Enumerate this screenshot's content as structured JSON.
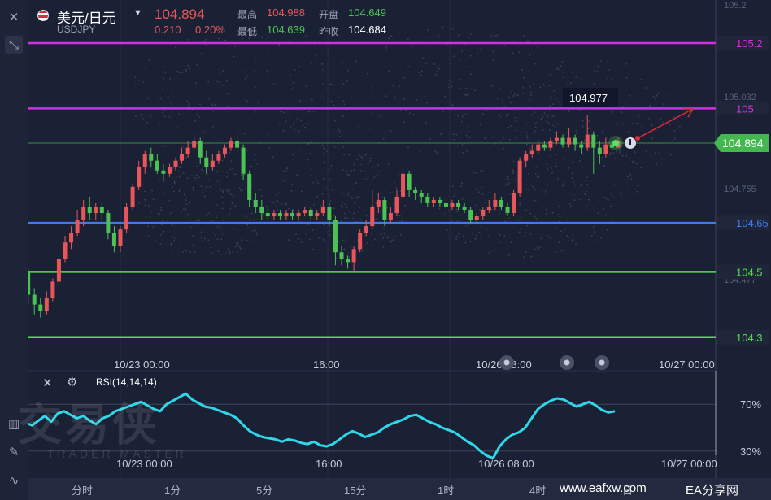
{
  "header": {
    "pair": "美元/日元",
    "symbol": "USDJPY",
    "price": "104.894",
    "change": "0.210",
    "change_pct": "0.20%",
    "high_label": "最高",
    "high": "104.988",
    "low_label": "最低",
    "low": "104.639",
    "open_label": "开盘",
    "open": "104.649",
    "prev_label": "昨收",
    "prev": "104.684"
  },
  "price_axis": {
    "ticks": [
      "105.2",
      "105.032",
      "104.755",
      "104.477"
    ],
    "current": "104.894"
  },
  "levels": [
    {
      "label": "105.2",
      "value": 105.2,
      "color": "#d62ee0"
    },
    {
      "label": "105",
      "value": 105.0,
      "color": "#d62ee0"
    },
    {
      "label": "104.65",
      "value": 104.65,
      "color": "#3d7bf0"
    },
    {
      "label": "104.5",
      "value": 104.5,
      "color": "#52e04a"
    },
    {
      "label": "104.3",
      "value": 104.3,
      "color": "#52e04a"
    }
  ],
  "peak_tooltip": "104.977",
  "time_axis": [
    "10/23 00:00",
    "16:00",
    "10/26 08:00",
    "10/27 00:00"
  ],
  "rsi": {
    "label": "RSI(14,14,14)",
    "levels": [
      "70%",
      "30%"
    ]
  },
  "periods": [
    "分时",
    "1分",
    "5分",
    "15分",
    "1时",
    "4时",
    "日"
  ],
  "watermark": {
    "brand": "交易侠",
    "brand_sub": "TRADER MASTER",
    "site": "www.eafxw.com",
    "name": "EA分享网"
  },
  "colors": {
    "up": "#e8565c",
    "down": "#4cc254",
    "rsi": "#2fd7e8",
    "bg": "#1b2134"
  },
  "chart_data": {
    "type": "candlestick",
    "symbol": "USDJPY",
    "ylim": [
      104.3,
      105.2
    ],
    "candles": [
      [
        104.57,
        104.56,
        104.6,
        104.53
      ],
      [
        104.56,
        104.55,
        104.58,
        104.52
      ],
      [
        104.55,
        104.5,
        104.56,
        104.48
      ],
      [
        104.5,
        104.43,
        104.51,
        104.4
      ],
      [
        104.43,
        104.4,
        104.45,
        104.37
      ],
      [
        104.4,
        104.38,
        104.42,
        104.36
      ],
      [
        104.38,
        104.42,
        104.44,
        104.37
      ],
      [
        104.42,
        104.47,
        104.48,
        104.41
      ],
      [
        104.47,
        104.54,
        104.55,
        104.46
      ],
      [
        104.54,
        104.59,
        104.61,
        104.53
      ],
      [
        104.59,
        104.62,
        104.64,
        104.57
      ],
      [
        104.62,
        104.66,
        104.69,
        104.61
      ],
      [
        104.66,
        104.7,
        104.72,
        104.64
      ],
      [
        104.7,
        104.68,
        104.73,
        104.66
      ],
      [
        104.68,
        104.7,
        104.71,
        104.66
      ],
      [
        104.7,
        104.68,
        104.71,
        104.66
      ],
      [
        104.68,
        104.62,
        104.69,
        104.6
      ],
      [
        104.62,
        104.58,
        104.64,
        104.56
      ],
      [
        104.58,
        104.63,
        104.64,
        104.56
      ],
      [
        104.63,
        104.7,
        104.71,
        104.62
      ],
      [
        104.7,
        104.76,
        104.77,
        104.69
      ],
      [
        104.76,
        104.82,
        104.84,
        104.75
      ],
      [
        104.82,
        104.86,
        104.87,
        104.8
      ],
      [
        104.86,
        104.84,
        104.88,
        104.82
      ],
      [
        104.84,
        104.81,
        104.86,
        104.8
      ],
      [
        104.81,
        104.8,
        104.83,
        104.78
      ],
      [
        104.8,
        104.82,
        104.83,
        104.79
      ],
      [
        104.82,
        104.84,
        104.85,
        104.81
      ],
      [
        104.84,
        104.86,
        104.88,
        104.83
      ],
      [
        104.86,
        104.88,
        104.9,
        104.85
      ],
      [
        104.88,
        104.9,
        104.92,
        104.87
      ],
      [
        104.9,
        104.85,
        104.91,
        104.83
      ],
      [
        104.85,
        104.82,
        104.87,
        104.8
      ],
      [
        104.82,
        104.84,
        104.86,
        104.81
      ],
      [
        104.84,
        104.86,
        104.87,
        104.83
      ],
      [
        104.86,
        104.88,
        104.89,
        104.85
      ],
      [
        104.88,
        104.9,
        104.91,
        104.87
      ],
      [
        104.9,
        104.88,
        104.92,
        104.86
      ],
      [
        104.88,
        104.8,
        104.89,
        104.78
      ],
      [
        104.8,
        104.72,
        104.81,
        104.7
      ],
      [
        104.72,
        104.7,
        104.74,
        104.68
      ],
      [
        104.7,
        104.68,
        104.72,
        104.66
      ],
      [
        104.68,
        104.67,
        104.7,
        104.66
      ],
      [
        104.67,
        104.68,
        104.69,
        104.66
      ],
      [
        104.68,
        104.67,
        104.69,
        104.66
      ],
      [
        104.67,
        104.68,
        104.69,
        104.66
      ],
      [
        104.68,
        104.67,
        104.69,
        104.66
      ],
      [
        104.67,
        104.68,
        104.69,
        104.66
      ],
      [
        104.68,
        104.69,
        104.7,
        104.67
      ],
      [
        104.69,
        104.67,
        104.7,
        104.66
      ],
      [
        104.67,
        104.68,
        104.69,
        104.66
      ],
      [
        104.68,
        104.7,
        104.72,
        104.67
      ],
      [
        104.7,
        104.66,
        104.71,
        104.64
      ],
      [
        104.66,
        104.56,
        104.67,
        104.52
      ],
      [
        104.56,
        104.54,
        104.58,
        104.52
      ],
      [
        104.54,
        104.53,
        104.55,
        104.51
      ],
      [
        104.53,
        104.57,
        104.58,
        104.5
      ],
      [
        104.57,
        104.62,
        104.63,
        104.56
      ],
      [
        104.62,
        104.64,
        104.66,
        104.61
      ],
      [
        104.64,
        104.7,
        104.75,
        104.63
      ],
      [
        104.7,
        104.72,
        104.74,
        104.68
      ],
      [
        104.72,
        104.66,
        104.73,
        104.64
      ],
      [
        104.66,
        104.68,
        104.7,
        104.65
      ],
      [
        104.68,
        104.73,
        104.75,
        104.67
      ],
      [
        104.73,
        104.8,
        104.82,
        104.72
      ],
      [
        104.8,
        104.75,
        104.81,
        104.73
      ],
      [
        104.75,
        104.74,
        104.76,
        104.72
      ],
      [
        104.74,
        104.73,
        104.75,
        104.71
      ],
      [
        104.73,
        104.71,
        104.74,
        104.7
      ],
      [
        104.71,
        104.72,
        104.73,
        104.7
      ],
      [
        104.72,
        104.71,
        104.73,
        104.7
      ],
      [
        104.71,
        104.7,
        104.72,
        104.69
      ],
      [
        104.7,
        104.71,
        104.72,
        104.69
      ],
      [
        104.71,
        104.7,
        104.72,
        104.69
      ],
      [
        104.7,
        104.69,
        104.71,
        104.68
      ],
      [
        104.69,
        104.66,
        104.7,
        104.65
      ],
      [
        104.66,
        104.67,
        104.68,
        104.65
      ],
      [
        104.67,
        104.69,
        104.7,
        104.66
      ],
      [
        104.69,
        104.7,
        104.72,
        104.68
      ],
      [
        104.7,
        104.72,
        104.74,
        104.69
      ],
      [
        104.72,
        104.7,
        104.73,
        104.69
      ],
      [
        104.7,
        104.68,
        104.71,
        104.67
      ],
      [
        104.68,
        104.74,
        104.75,
        104.67
      ],
      [
        104.74,
        104.84,
        104.85,
        104.73
      ],
      [
        104.84,
        104.86,
        104.87,
        104.82
      ],
      [
        104.86,
        104.87,
        104.89,
        104.85
      ],
      [
        104.87,
        104.89,
        104.9,
        104.86
      ],
      [
        104.89,
        104.88,
        104.9,
        104.87
      ],
      [
        104.88,
        104.9,
        104.91,
        104.87
      ],
      [
        104.9,
        104.91,
        104.93,
        104.89
      ],
      [
        104.91,
        104.89,
        104.92,
        104.88
      ],
      [
        104.89,
        104.91,
        104.94,
        104.88
      ],
      [
        104.91,
        104.89,
        104.92,
        104.87
      ],
      [
        104.89,
        104.88,
        104.9,
        104.86
      ],
      [
        104.88,
        104.92,
        104.98,
        104.87
      ],
      [
        104.92,
        104.88,
        104.93,
        104.8
      ],
      [
        104.88,
        104.86,
        104.9,
        104.83
      ],
      [
        104.86,
        104.89,
        104.91,
        104.85
      ],
      [
        104.89,
        104.88,
        104.9,
        104.87
      ],
      [
        104.88,
        104.9,
        104.91,
        104.88
      ]
    ],
    "candle_format": [
      "open",
      "close",
      "high",
      "low"
    ],
    "rsi_values": [
      60,
      58,
      62,
      57,
      54,
      52,
      56,
      60,
      55,
      62,
      64,
      61,
      58,
      60,
      56,
      53,
      58,
      60,
      64,
      66,
      68,
      70,
      72,
      69,
      66,
      64,
      70,
      73,
      76,
      79,
      74,
      71,
      68,
      67,
      65,
      63,
      61,
      58,
      52,
      47,
      44,
      42,
      41,
      40,
      38,
      40,
      39,
      37,
      36,
      38,
      35,
      34,
      36,
      40,
      44,
      47,
      45,
      42,
      44,
      46,
      50,
      53,
      55,
      57,
      60,
      61,
      58,
      55,
      53,
      50,
      48,
      46,
      42,
      38,
      35,
      30,
      26,
      24,
      34,
      40,
      44,
      46,
      50,
      58,
      66,
      70,
      73,
      75,
      74,
      71,
      68,
      70,
      72,
      69,
      65,
      63,
      64
    ],
    "rsi_range": [
      0,
      100
    ]
  }
}
